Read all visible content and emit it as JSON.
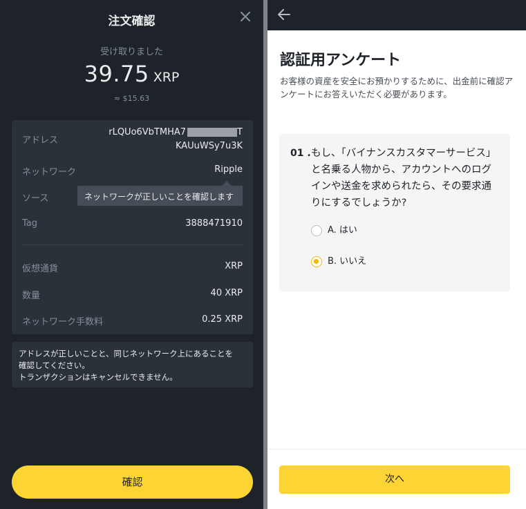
{
  "order_confirm": {
    "title": "注文確認",
    "received_label": "受け取りました",
    "amount": "39.75",
    "amount_unit": "XRP",
    "fiat_value": "≈ $15.63",
    "details": {
      "address_label": "アドレス",
      "address_line1": "rLQUo6VbTMHA7",
      "address_line1_end": "T",
      "address_line2": "KAUuWSy7u3K",
      "network_label": "ネットワーク",
      "network_value": "Ripple",
      "source_label": "ソース",
      "tag_label": "Tag",
      "tag_value": "3888471910",
      "currency_label": "仮想通貨",
      "currency_value": "XRP",
      "quantity_label": "数量",
      "quantity_value": "40 XRP",
      "fee_label": "ネットワーク手数料",
      "fee_value": "0.25 XRP"
    },
    "tooltip": "ネットワークが正しいことを確認します",
    "notice_line1": "アドレスが正しいことと、同じネットワーク上にあることを",
    "notice_line2": "確認してください。",
    "notice_line3": "トランザクションはキャンセルできません。",
    "confirm_label": "確認"
  },
  "survey": {
    "title": "認証用アンケート",
    "description": "お客様の資産を安全にお預かりするために、出金前に確認アンケートにお答えいただく必要があります。",
    "question_number": "01 .",
    "question_text": "もし、「バイナンスカスタマーサービス」と名乗る人物から、アカウントへのログインや送金を求められたら、その要求通りにするでしょうか?",
    "options": [
      {
        "label": "A. はい",
        "selected": false
      },
      {
        "label": "B. いいえ",
        "selected": true
      }
    ],
    "next_label": "次へ"
  },
  "colors": {
    "accent": "#fcd535",
    "dark_bg": "#1e2329",
    "card_bg": "#2b3139"
  }
}
